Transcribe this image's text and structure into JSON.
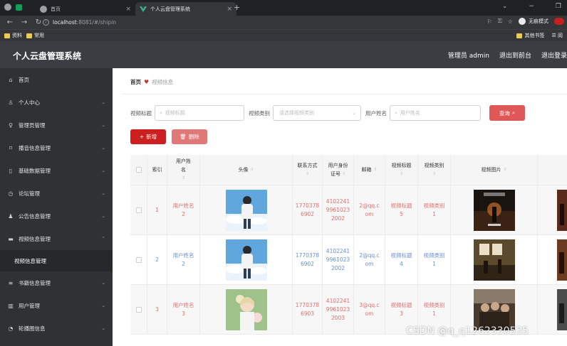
{
  "browser": {
    "inactive_tab_title": "首页",
    "active_tab_title": "个人云盘管理系统",
    "url_host": "localhost",
    "url_path": ":8081/#/shipin",
    "incognito_label": "无痕模式",
    "bookmarks": [
      "资料",
      "常用"
    ],
    "other_bookmarks": "其他书签",
    "reading_list": "阅"
  },
  "header": {
    "title": "个人云盘管理系统",
    "links": [
      "管理员 admin",
      "退出到前台",
      "退出登录"
    ]
  },
  "sidebar": {
    "items": [
      {
        "icon": "home-icon",
        "label": "首页",
        "arrow": false
      },
      {
        "icon": "user-icon",
        "label": "个人中心",
        "arrow": true
      },
      {
        "icon": "admin-icon",
        "label": "管理员管理",
        "arrow": true
      },
      {
        "icon": "music-icon",
        "label": "播音信息管理",
        "arrow": true
      },
      {
        "icon": "database-icon",
        "label": "基础数据管理",
        "arrow": true
      },
      {
        "icon": "forum-icon",
        "label": "论坛管理",
        "arrow": true
      },
      {
        "icon": "notice-icon",
        "label": "公告信息管理",
        "arrow": true
      },
      {
        "icon": "video-icon",
        "label": "视频信息管理",
        "arrow": true,
        "expanded": true
      },
      {
        "icon": "book-icon",
        "label": "书籍信息管理",
        "arrow": true
      },
      {
        "icon": "users-icon",
        "label": "用户管理",
        "arrow": true
      },
      {
        "icon": "carousel-icon",
        "label": "轮播图信息",
        "arrow": true
      }
    ],
    "subitem": "视频信息管理"
  },
  "breadcrumb": {
    "home": "首页",
    "current": "视频信息"
  },
  "search": {
    "title_label": "视频标题",
    "title_placeholder": "视频标题",
    "type_label": "视频类别",
    "type_placeholder": "请选择视频类别",
    "user_label": "用户姓名",
    "user_placeholder": "用户姓名",
    "query_button": "查询"
  },
  "actions": {
    "add": "新增",
    "delete": "删除"
  },
  "table": {
    "headers": [
      "索引",
      "用户姓名",
      "头像",
      "联系方式",
      "用户身份证号",
      "邮箱",
      "视频标题",
      "视频类别",
      "视频图片"
    ],
    "header_lines": {
      "name": [
        "用户姓",
        "名"
      ],
      "idcard": [
        "用户身份",
        "证号"
      ]
    },
    "rows": [
      {
        "index": "1",
        "name": [
          "用户姓名",
          "2"
        ],
        "phone": [
          "1770378",
          "6902"
        ],
        "idcard": [
          "4102241",
          "9961023",
          "2002"
        ],
        "email": [
          "2@qq.c",
          "om"
        ],
        "title": [
          "视频标题",
          "5"
        ],
        "category": [
          "视频类别",
          "1"
        ]
      },
      {
        "index": "2",
        "name": [
          "用户姓名",
          "2"
        ],
        "phone": [
          "1770378",
          "6902"
        ],
        "idcard": [
          "4102241",
          "9961023",
          "2002"
        ],
        "email": [
          "2@qq.c",
          "om"
        ],
        "title": [
          "视频标题",
          "4"
        ],
        "category": [
          "视频类别",
          "1"
        ]
      },
      {
        "index": "3",
        "name": [
          "用户姓名",
          "3"
        ],
        "phone": [
          "1770378",
          "6903"
        ],
        "idcard": [
          "4102241",
          "9961023",
          "2003"
        ],
        "email": [
          "3@qq.c",
          "om"
        ],
        "title": [
          "视频标题",
          "3"
        ],
        "category": [
          "视频类别",
          "1"
        ]
      }
    ]
  },
  "watermark": "CSDN @q_q1262330535",
  "colors": {
    "header_bg": "#3a3d42",
    "sidebar_bg": "#2f3135",
    "accent_red": "#cc1f1f",
    "link_red": "#e0706c",
    "link_blue": "#6a8fd0"
  }
}
